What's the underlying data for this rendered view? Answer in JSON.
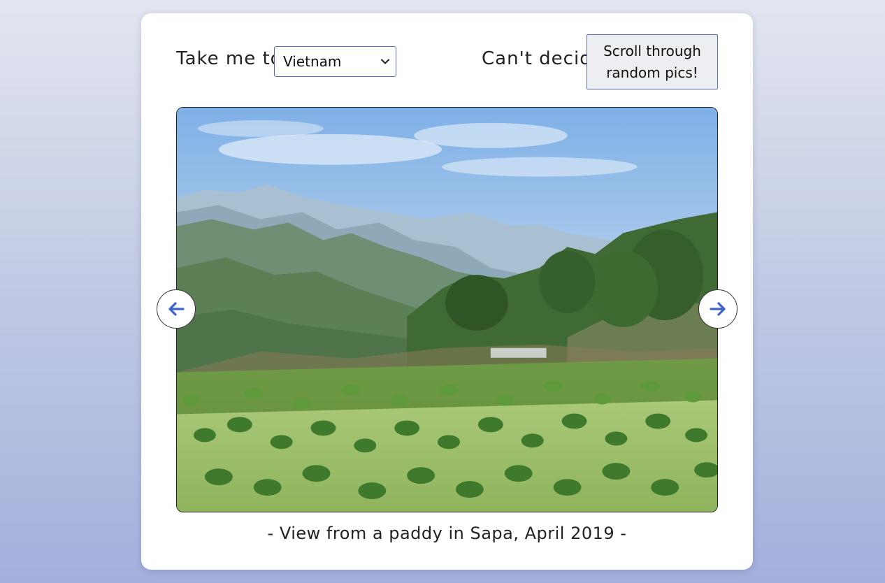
{
  "nav": {
    "take_me_to_label": "Take me to:",
    "destination_selected": "Vietnam",
    "cant_decide_label": "Can't decide?",
    "random_button_label": "Scroll through random pics!"
  },
  "gallery": {
    "caption": "- View from a paddy in Sapa, April 2019 -",
    "prev_icon": "arrow-left-icon",
    "next_icon": "arrow-right-icon"
  },
  "colors": {
    "accent": "#3b63c9",
    "border": "#5a6fb8"
  }
}
